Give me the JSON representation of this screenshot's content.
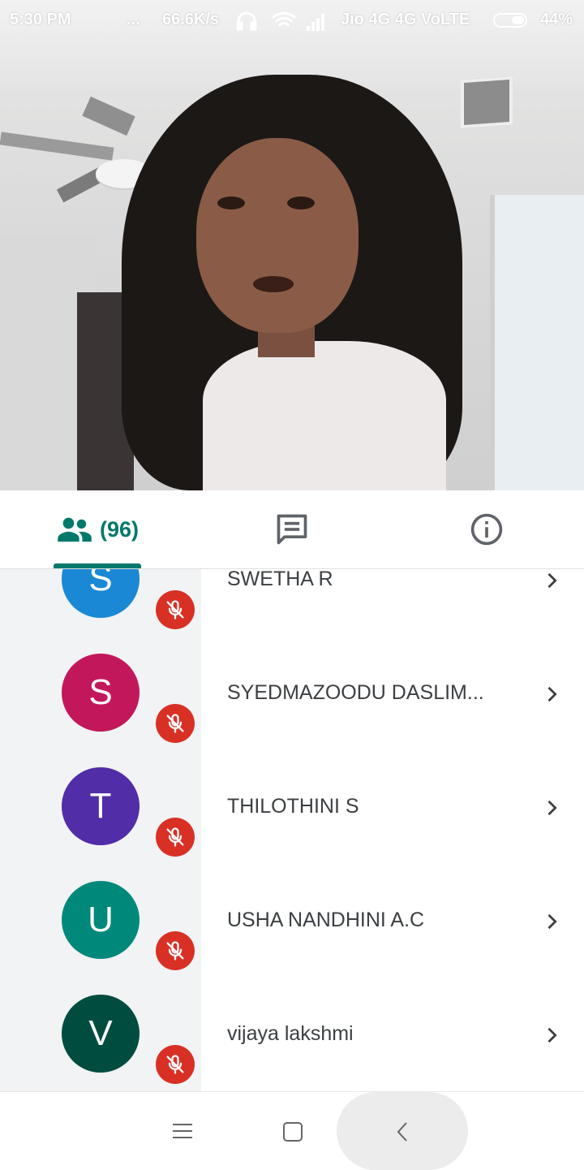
{
  "status_bar": {
    "time": "5:30 PM",
    "dots": "...",
    "speed": "66.6K/s",
    "carrier": "Jio 4G 4G VoLTE",
    "battery": "44%",
    "battery_level": 0.44
  },
  "tabs": {
    "people_count": "(96)",
    "active": "people"
  },
  "participants": [
    {
      "initial": "S",
      "name": "SWETHA R",
      "color": "#1a88d4",
      "muted": true
    },
    {
      "initial": "S",
      "name": "SYEDMAZOODU DASLIM...",
      "color": "#c2185b",
      "muted": true
    },
    {
      "initial": "T",
      "name": "THILOTHINI S",
      "color": "#512da8",
      "muted": true
    },
    {
      "initial": "U",
      "name": "USHA NANDHINI A.C",
      "color": "#00897b",
      "muted": true
    },
    {
      "initial": "V",
      "name": "vijaya lakshmi",
      "color": "#004d40",
      "muted": true
    }
  ],
  "colors": {
    "accent": "#00796b",
    "mute_badge": "#d93025"
  },
  "icons": {
    "people": "people-icon",
    "chat": "chat-icon",
    "info": "info-icon",
    "mic_off": "mic-off-icon",
    "chevron": "chevron-right-icon"
  }
}
